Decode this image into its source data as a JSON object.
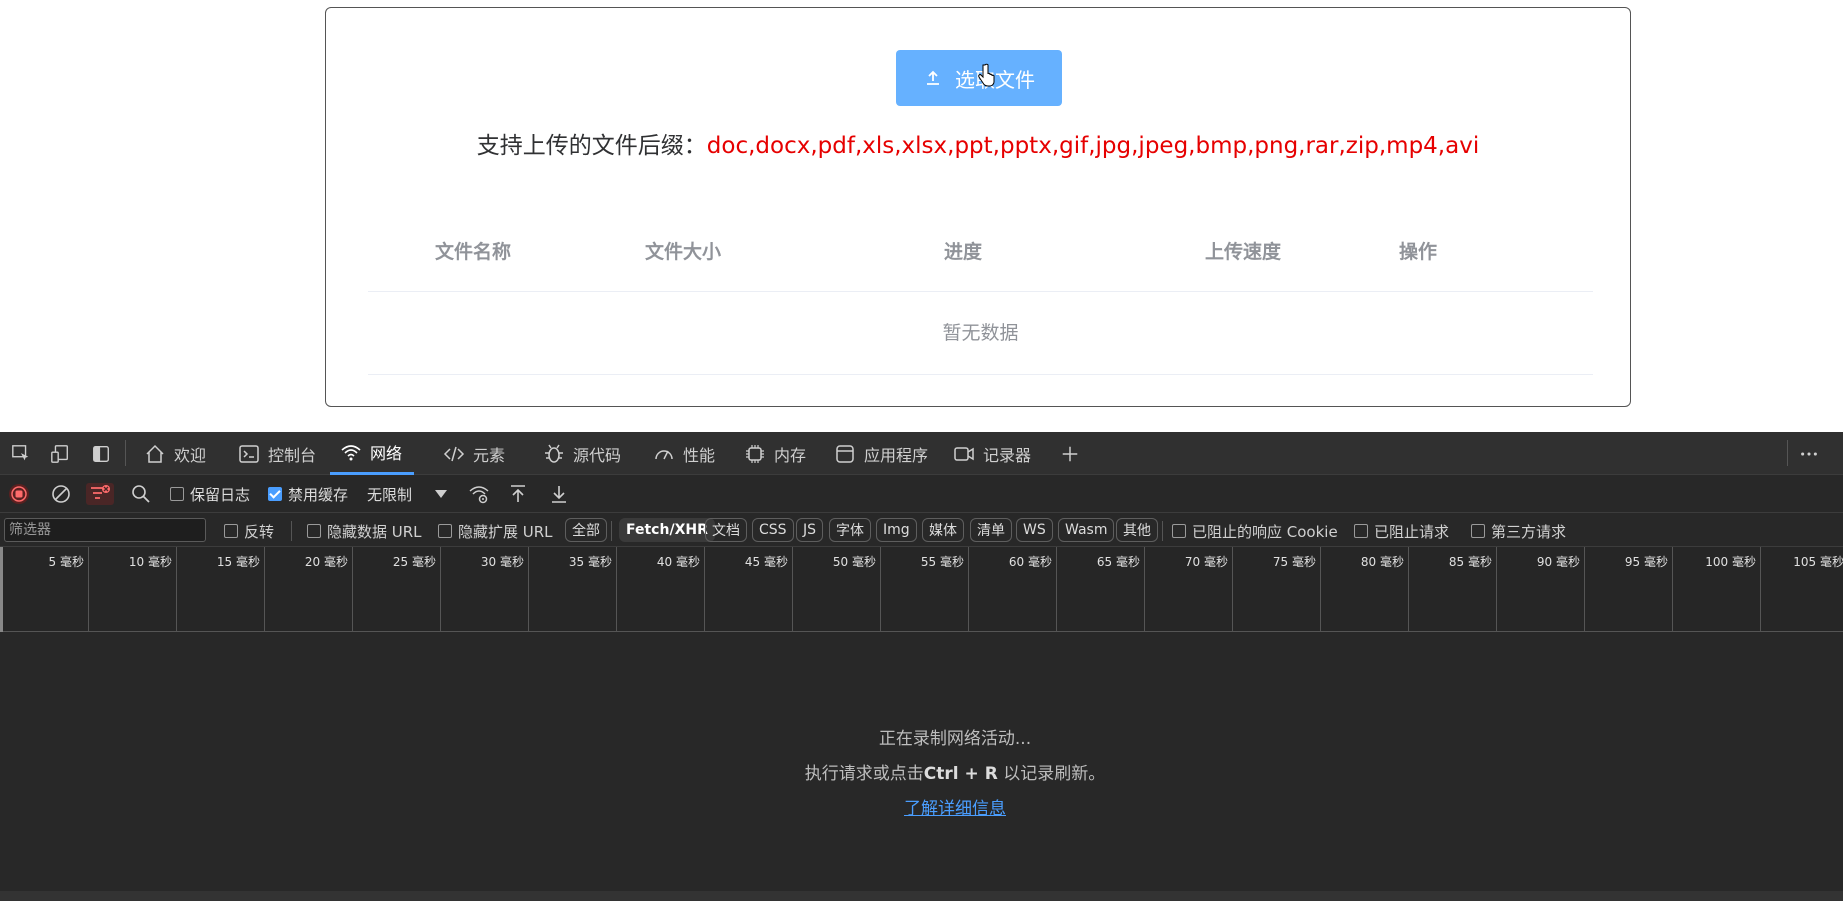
{
  "page": {
    "upload_button_label": "选取文件",
    "hint_prefix": "支持上传的文件后缀：",
    "hint_extensions": "doc,docx,pdf,xls,xlsx,ppt,pptx,gif,jpg,jpeg,bmp,png,rar,zip,mp4,avi",
    "table": {
      "columns": [
        "文件名称",
        "文件大小",
        "进度",
        "上传速度",
        "操作"
      ],
      "empty_text": "暂无数据"
    }
  },
  "devtools": {
    "tabs": [
      {
        "label": "欢迎",
        "icon": "home-icon"
      },
      {
        "label": "控制台",
        "icon": "console-icon"
      },
      {
        "label": "网络",
        "icon": "wifi-icon",
        "active": true
      },
      {
        "label": "元素",
        "icon": "code-icon"
      },
      {
        "label": "源代码",
        "icon": "bug-icon"
      },
      {
        "label": "性能",
        "icon": "gauge-icon"
      },
      {
        "label": "内存",
        "icon": "chip-icon"
      },
      {
        "label": "应用程序",
        "icon": "app-icon"
      },
      {
        "label": "记录器",
        "icon": "camera-icon"
      }
    ],
    "toolbar": {
      "preserve_log": "保留日志",
      "preserve_log_checked": false,
      "disable_cache": "禁用缓存",
      "disable_cache_checked": true,
      "throttling": "无限制"
    },
    "filter": {
      "placeholder": "筛选器",
      "invert": "反转",
      "hide_data_url": "隐藏数据 URL",
      "hide_ext_url": "隐藏扩展 URL",
      "types": [
        "全部",
        "Fetch/XHR",
        "文档",
        "CSS",
        "JS",
        "字体",
        "Img",
        "媒体",
        "清单",
        "WS",
        "Wasm",
        "其他"
      ],
      "selected_type": "Fetch/XHR",
      "blocked_cookies": "已阻止的响应 Cookie",
      "blocked_requests": "已阻止请求",
      "third_party": "第三方请求"
    },
    "timeline_ticks": [
      "5 毫秒",
      "10 毫秒",
      "15 毫秒",
      "20 毫秒",
      "25 毫秒",
      "30 毫秒",
      "35 毫秒",
      "40 毫秒",
      "45 毫秒",
      "50 毫秒",
      "55 毫秒",
      "60 毫秒",
      "65 毫秒",
      "70 毫秒",
      "75 毫秒",
      "80 毫秒",
      "85 毫秒",
      "90 毫秒",
      "95 毫秒",
      "100 毫秒",
      "105 毫秒"
    ],
    "empty": {
      "recording": "正在录制网络活动...",
      "hint_before": "执行请求或点击",
      "hint_shortcut": "Ctrl + R",
      "hint_after": "以记录刷新。",
      "learn_more": "了解详细信息"
    },
    "accent_color": "#4a9eff"
  }
}
